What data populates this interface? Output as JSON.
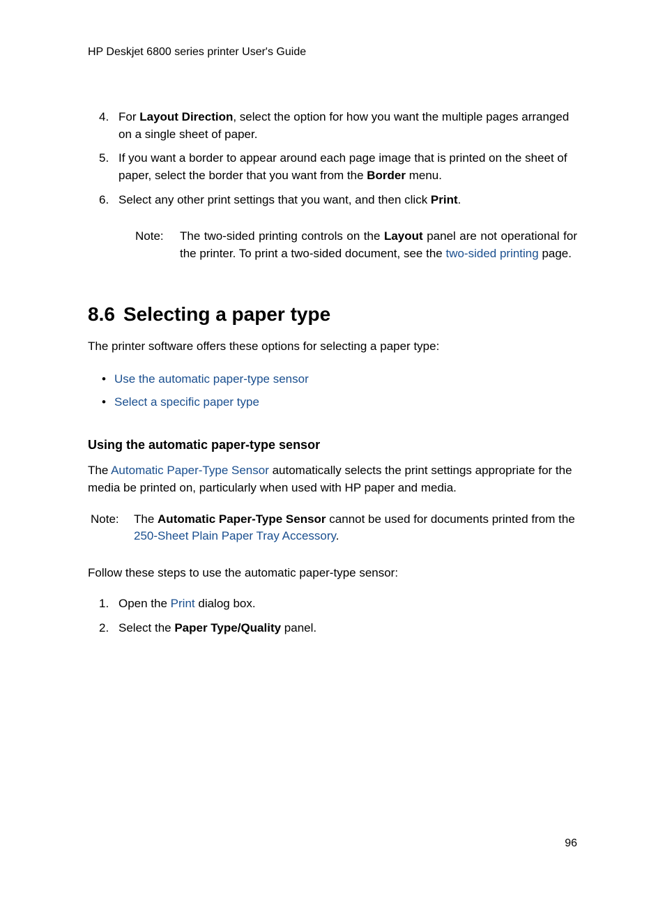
{
  "header": "HP Deskjet 6800 series printer User's Guide",
  "steps": {
    "step4": {
      "num": "4.",
      "pre": " For ",
      "bold1": "Layout Direction",
      "post": ", select the option for how you want the multiple pages arranged on a single sheet of paper."
    },
    "step5": {
      "num": "5.",
      "pre": " If you want a border to appear around each page image that is printed on the sheet of paper, select the border that you want from the ",
      "bold1": "Border",
      "post": " menu."
    },
    "step6": {
      "num": "6.",
      "pre": " Select any other print settings that you want, and then click ",
      "bold1": "Print",
      "post": "."
    }
  },
  "note1": {
    "label": "Note:",
    "part1": "The two-sided printing controls on the ",
    "bold1": "Layout",
    "part2": " panel are not operational for the printer. To print a two-sided document, see the ",
    "link1": "two-sided printing",
    "part3": " page."
  },
  "section": {
    "num": "8.6",
    "title": "Selecting a paper type"
  },
  "intro": "The printer software offers these options for selecting a paper type:",
  "bullets": {
    "b1": "Use the automatic paper-type sensor",
    "b2": "Select a specific paper type"
  },
  "sub1": {
    "heading": "Using the automatic paper-type sensor",
    "para_pre": "The ",
    "para_link": "Automatic Paper-Type Sensor",
    "para_post": " automatically selects the print settings appropriate for the media be printed on, particularly when used with HP paper and media."
  },
  "note2": {
    "label": "Note:",
    "part1": "The ",
    "bold1": "Automatic Paper-Type Sensor",
    "part2": " cannot be used for documents printed from the ",
    "link1": "250-Sheet Plain Paper Tray Accessory",
    "part3": "."
  },
  "followsteps": "Follow these steps to use the automatic paper-type sensor:",
  "steps2": {
    "s1": {
      "num": "1.",
      "pre": " Open the ",
      "link": "Print",
      "post": " dialog box."
    },
    "s2": {
      "num": "2.",
      "pre": " Select the ",
      "bold": "Paper Type/Quality",
      "post": " panel."
    }
  },
  "pagenum": "96"
}
